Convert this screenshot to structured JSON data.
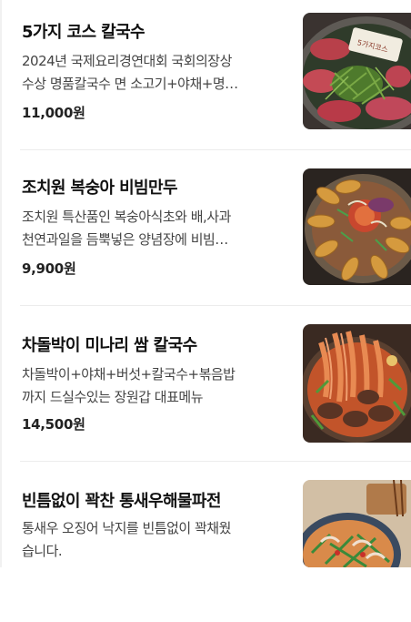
{
  "menu": {
    "items": [
      {
        "name": "5가지 코스 칼국수",
        "desc_line1": "2024년 국제요리경연대회 국회의장상",
        "desc_line2": "수상 명품칼국수 면 소고기+야채+명…",
        "price": "11,000원",
        "image_icon": "beef-noodle-hotpot-photo",
        "logo_text": "5가지코스"
      },
      {
        "name": "조치원 복숭아 비빔만두",
        "desc_line1": "조치원 특산품인 복숭아식초와 배,사과",
        "desc_line2": "천연과일을 듬뿍넣은 양념장에 비빔…",
        "price": "9,900원",
        "image_icon": "bibim-dumpling-photo"
      },
      {
        "name": "차돌박이 미나리 쌈 칼국수",
        "desc_line1": "차돌박이+야채+버섯+칼국수+볶음밥",
        "desc_line2": "까지 드실수있는 장원갑 대표메뉴",
        "price": "14,500원",
        "image_icon": "spicy-noodle-hotpot-photo"
      },
      {
        "name": "빈틈없이 꽉찬 통새우해물파전",
        "desc_line1": "통새우 오징어 낙지를 빈틈없이 꽉채웠",
        "desc_line2": "습니다.",
        "price": "",
        "image_icon": "seafood-pancake-photo"
      }
    ]
  }
}
